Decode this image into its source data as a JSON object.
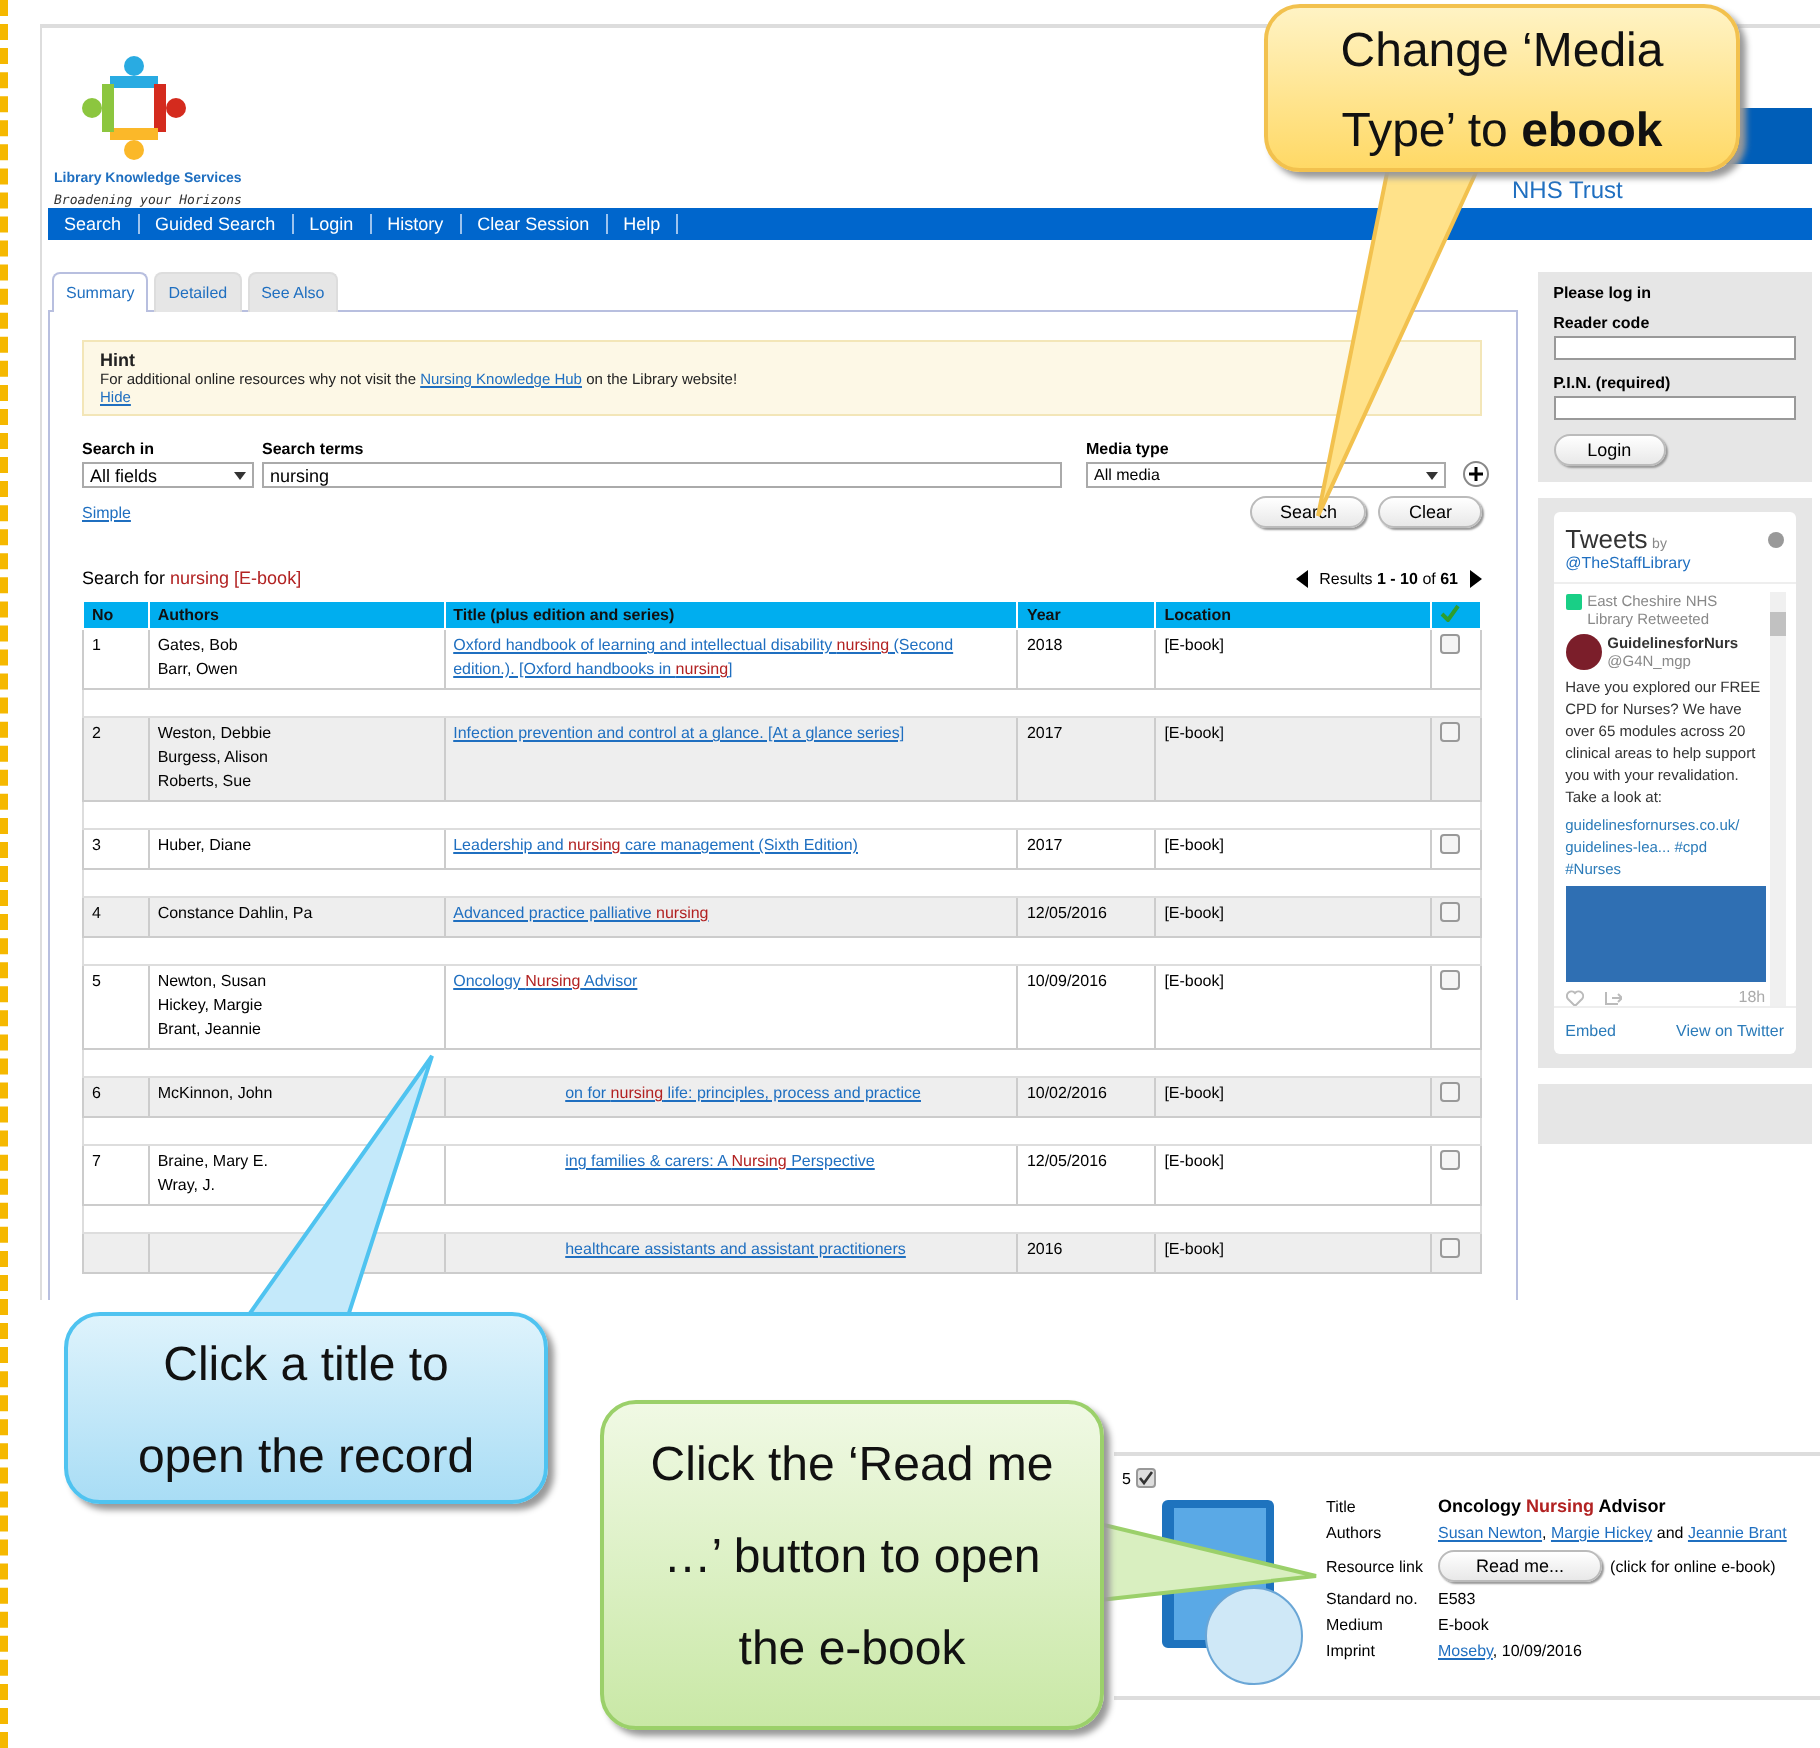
{
  "brand": {
    "name": "Library Knowledge Services",
    "tagline": "Broadening your Horizons",
    "trust": "NHS Trust"
  },
  "nav": [
    "Search",
    "Guided Search",
    "Login",
    "History",
    "Clear Session",
    "Help"
  ],
  "tabs": [
    {
      "label": "Summary",
      "selected": true
    },
    {
      "label": "Detailed",
      "selected": false
    },
    {
      "label": "See Also",
      "selected": false
    }
  ],
  "hint": {
    "title": "Hint",
    "text": "For additional online resources why not visit the ",
    "link": "Nursing Knowledge Hub",
    "text_after": " on the Library website!",
    "hide": "Hide"
  },
  "search": {
    "search_in_label": "Search in",
    "search_in_value": "All fields",
    "terms_label": "Search terms",
    "terms_value": "nursing",
    "media_label": "Media type",
    "media_value": "All media",
    "simple_link": "Simple",
    "buttons": [
      "Search",
      "Clear"
    ]
  },
  "results": {
    "prefix": "Search for ",
    "query": "nursing [E-book]",
    "pager": "Results **1 - 10** of **61**"
  },
  "table": {
    "columns": [
      "No",
      "Authors",
      "Title (plus edition and series)",
      "Year",
      "Location"
    ],
    "rows": [
      {
        "no": "1",
        "authors": [
          "Gates, Bob",
          "Barr, Owen"
        ],
        "title": [
          {
            "text": "Oxford handbook of learning and intellectual disability ",
            "highlight": false
          },
          {
            "text": "nursing",
            "highlight": true
          },
          {
            "text": " (Second edition.). [Oxford handbooks in ",
            "highlight": false
          },
          {
            "text": "nursing",
            "highlight": true
          },
          {
            "text": "]",
            "highlight": false
          }
        ],
        "year": "2018",
        "location": "[E-book]",
        "checked": false
      },
      {
        "no": "2",
        "authors": [
          "Weston, Debbie",
          "Burgess, Alison",
          "Roberts, Sue"
        ],
        "title": [
          {
            "text": "Infection prevention and control at a glance. [At a glance series]",
            "highlight": false
          }
        ],
        "year": "2017",
        "location": "[E-book]",
        "checked": false
      },
      {
        "no": "3",
        "authors": [
          "Huber, Diane"
        ],
        "title": [
          {
            "text": "Leadership and ",
            "highlight": false
          },
          {
            "text": "nursing",
            "highlight": true
          },
          {
            "text": " care management (Sixth Edition)",
            "highlight": false
          }
        ],
        "year": "2017",
        "location": "[E-book]",
        "checked": false
      },
      {
        "no": "4",
        "authors": [
          "Constance Dahlin, Pa"
        ],
        "title": [
          {
            "text": "Advanced practice palliative ",
            "highlight": false
          },
          {
            "text": "nursing",
            "highlight": true
          }
        ],
        "year": "12/05/2016",
        "location": "[E-book]",
        "checked": false
      },
      {
        "no": "5",
        "authors": [
          "Newton, Susan",
          "Hickey, Margie",
          "Brant, Jeannie"
        ],
        "title": [
          {
            "text": "Oncology ",
            "highlight": false
          },
          {
            "text": "Nursing",
            "highlight": true
          },
          {
            "text": " Advisor",
            "highlight": false
          }
        ],
        "year": "10/09/2016",
        "location": "[E-book]",
        "checked": false
      },
      {
        "no": "6",
        "authors": [
          "McKinnon, John"
        ],
        "title": [
          {
            "text": "on for ",
            "highlight": false
          },
          {
            "text": "nursing",
            "highlight": true
          },
          {
            "text": " life: principles, process and practice",
            "highlight": false
          }
        ],
        "year": "10/02/2016",
        "location": "[E-book]",
        "checked": false
      },
      {
        "no": "7",
        "authors": [
          "Braine, Mary E.",
          "Wray, J."
        ],
        "title": [
          {
            "text": "ing families & carers: A ",
            "highlight": false
          },
          {
            "text": "Nursing",
            "highlight": true
          },
          {
            "text": " Perspective",
            "highlight": false
          }
        ],
        "year": "12/05/2016",
        "location": "[E-book]",
        "checked": false
      },
      {
        "title": [
          {
            "text": "healthcare assistants and assistant practitioners",
            "highlight": false
          }
        ],
        "year": "2016",
        "location": "[E-book]",
        "checked": false
      }
    ]
  },
  "login": {
    "heading": "Please log in",
    "reader_label": "Reader code",
    "pin_label": "P.I.N. (required)",
    "button": "Login"
  },
  "tweets": {
    "title": "Tweets",
    "by": "by",
    "handle": "@TheStaffLibrary",
    "retweet": "East Cheshire NHS Library Retweeted",
    "author": "GuidelinesforNurs",
    "author_handle": "@G4N_mgp",
    "body": "Have you explored our FREE CPD for Nurses? We have over 65 modules across 20 clinical areas to help support you with your revalidation. Take a look at:",
    "link": "guidelinesfornurses.co.uk/ guidelines-lea... #cpd #Nurses",
    "time": "18h",
    "footer": [
      "Embed",
      "View on Twitter"
    ]
  },
  "record": {
    "no": "5",
    "checked": true,
    "fields": [
      {
        "label": "Title",
        "kind": "title",
        "parts": [
          {
            "text": "Oncology ",
            "highlight": false
          },
          {
            "text": "Nursing",
            "highlight": true
          },
          {
            "text": " Advisor",
            "highlight": false
          }
        ]
      },
      {
        "label": "Authors",
        "kind": "links",
        "parts": [
          {
            "text": "Susan Newton",
            "link": true,
            "after": ", "
          },
          {
            "text": "Margie Hickey",
            "link": true,
            "after": " and "
          },
          {
            "text": "Jeannie Brant",
            "link": true
          }
        ]
      },
      {
        "label": "Resource link",
        "kind": "button",
        "button": "Read me...",
        "note": "(click for online e-book)"
      },
      {
        "label": "Standard no.",
        "kind": "text",
        "value": "E583"
      },
      {
        "label": "Medium",
        "kind": "text",
        "value": "E-book"
      },
      {
        "label": "Imprint",
        "kind": "links",
        "parts": [
          {
            "text": "Moseby",
            "link": true,
            "after": ", 10/09/2016"
          }
        ]
      }
    ]
  },
  "callouts": [
    {
      "kind": "media",
      "text": "Change ‘Media Type’ to **ebook**"
    },
    {
      "kind": "title",
      "text": "Click a title to open the record"
    },
    {
      "kind": "read",
      "text": "Click the ‘Read me …’ button to open the e-book"
    }
  ]
}
